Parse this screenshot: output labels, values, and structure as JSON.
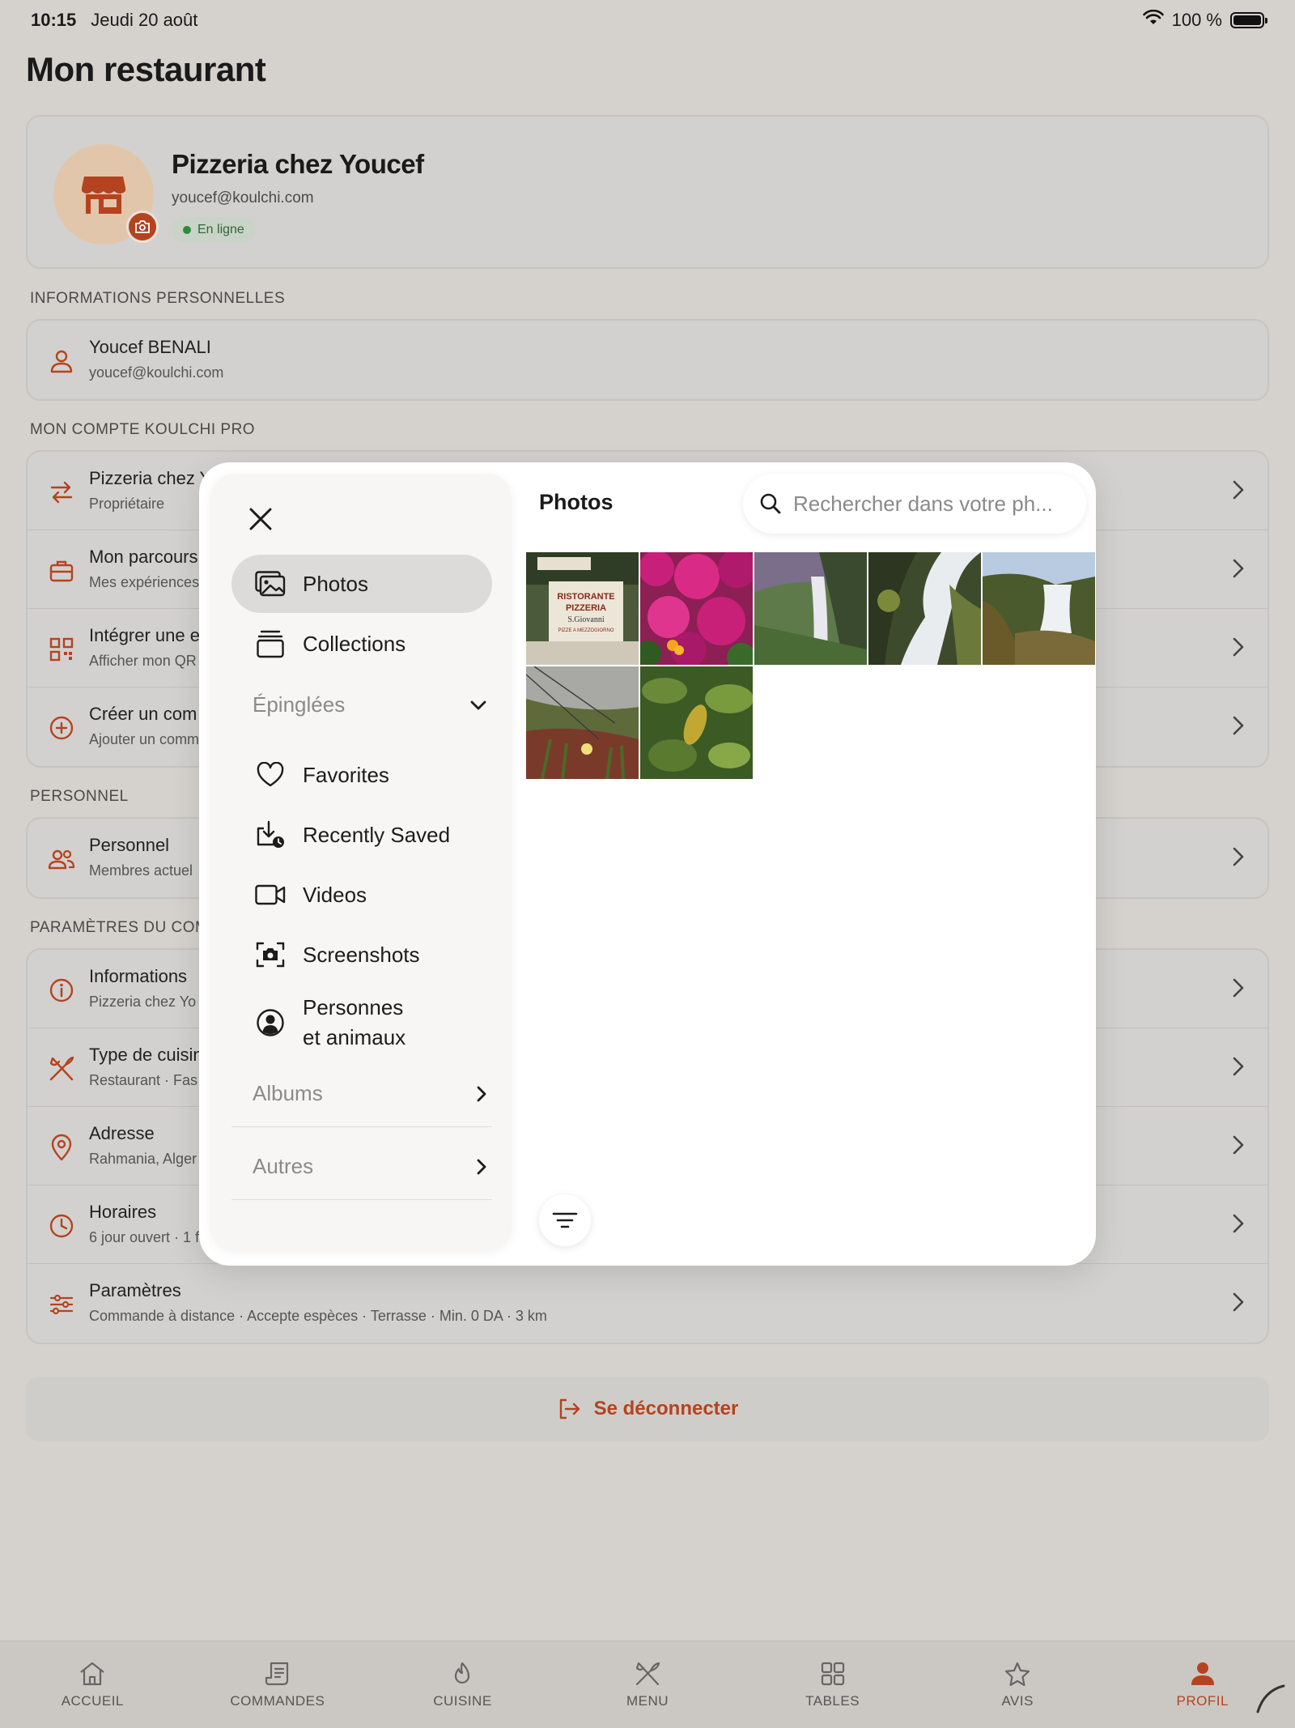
{
  "status_bar": {
    "time": "10:15",
    "date": "Jeudi 20 août",
    "battery": "100 %"
  },
  "page_title": "Mon restaurant",
  "profile": {
    "name": "Pizzeria chez Youcef",
    "email": "youcef@koulchi.com",
    "status": "En ligne"
  },
  "sections": {
    "personal_info": "INFORMATIONS PERSONNELLES",
    "account": "MON COMPTE KOULCHI PRO",
    "staff": "PERSONNEL",
    "settings": "PARAMÈTRES DU COM"
  },
  "personal_row": {
    "title": "Youcef BENALI",
    "sub": "youcef@koulchi.com"
  },
  "account_rows": [
    {
      "title": "Pizzeria chez Y",
      "sub": "Propriétaire"
    },
    {
      "title": "Mon parcours",
      "sub": "Mes expériences"
    },
    {
      "title": "Intégrer une e",
      "sub": "Afficher mon QR"
    },
    {
      "title": "Créer un com",
      "sub": "Ajouter un comm"
    }
  ],
  "staff_row": {
    "title": "Personnel",
    "sub": "Membres actuel"
  },
  "settings_rows": [
    {
      "title": "Informations",
      "sub": "Pizzeria chez Yo"
    },
    {
      "title": "Type de cuisin",
      "sub": "Restaurant · Fas"
    },
    {
      "title": "Adresse",
      "sub": "Rahmania, Alger"
    },
    {
      "title": "Horaires",
      "sub": "6 jour ouvert · 1 f"
    },
    {
      "title": "Paramètres",
      "sub": "Commande à distance · Accepte espèces · Terrasse · Min. 0 DA · 3 km"
    }
  ],
  "logout_label": "Se déconnecter",
  "tabs": [
    "ACCUEIL",
    "COMMANDES",
    "CUISINE",
    "MENU",
    "TABLES",
    "AVIS",
    "PROFIL"
  ],
  "picker": {
    "title": "Photos",
    "search_placeholder": "Rechercher dans votre ph...",
    "items": {
      "photos": "Photos",
      "collections": "Collections",
      "pinned": "Épinglées",
      "favorites": "Favorites",
      "recently_saved": "Recently Saved",
      "videos": "Videos",
      "screenshots": "Screenshots",
      "people_line1": "Personnes",
      "people_line2": "et animaux",
      "albums": "Albums",
      "others": "Autres"
    },
    "photo_sign": {
      "l1": "RISTORANTE",
      "l2": "PIZZERIA",
      "l3": "S.Giovanni",
      "l4": "PIZZE A MEZZOGIORNO"
    }
  },
  "colors": {
    "accent": "#b5431f",
    "online": "#2b8c3c"
  }
}
